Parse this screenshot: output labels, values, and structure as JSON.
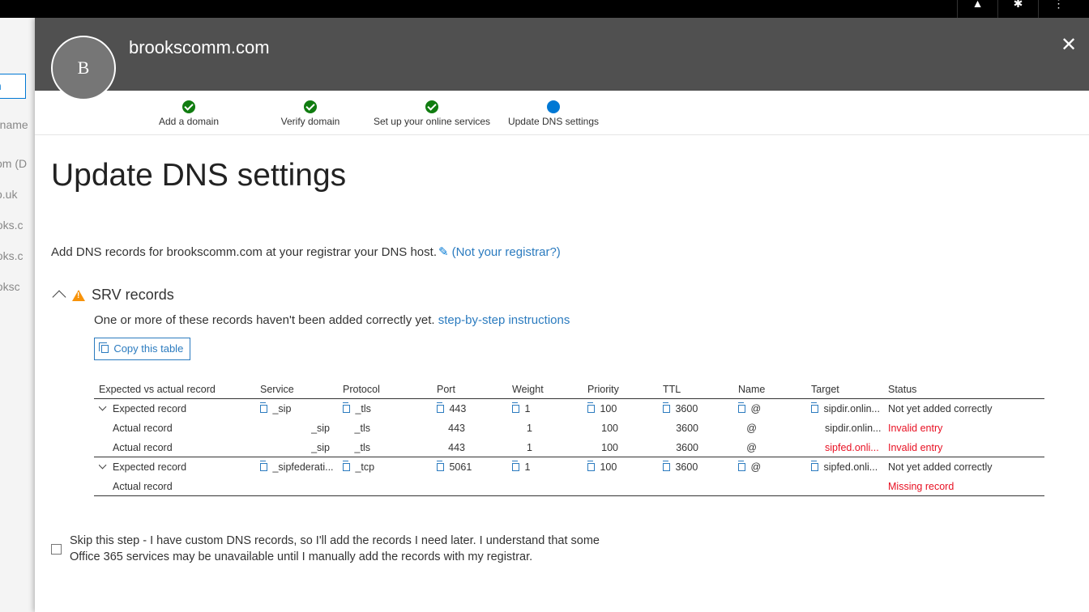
{
  "bg_page": {
    "button_label": "ain",
    "rows": [
      "n name",
      "com (D",
      "co.uk",
      "ooks.c",
      "ooks.c",
      "ooksc"
    ]
  },
  "panel": {
    "avatar_letter": "B",
    "title": "brookscomm.com",
    "close_label": "✕"
  },
  "steps": [
    {
      "label": "Add a domain",
      "state": "done"
    },
    {
      "label": "Verify domain",
      "state": "done"
    },
    {
      "label": "Set up your online services",
      "state": "done"
    },
    {
      "label": "Update DNS settings",
      "state": "current"
    }
  ],
  "page_title": "Update DNS settings",
  "intro": {
    "text": "Add DNS records for brookscomm.com at your registrar your DNS host.",
    "link": "(Not your registrar?)"
  },
  "srv": {
    "title": "SRV records",
    "message": "One or more of these records haven't been added correctly yet.",
    "link": "step-by-step instructions",
    "copy_button": "Copy this table"
  },
  "table": {
    "headers": [
      "Expected vs actual record",
      "Service",
      "Protocol",
      "Port",
      "Weight",
      "Priority",
      "TTL",
      "Name",
      "Target",
      "Status"
    ],
    "rows": [
      {
        "kind": "expected",
        "label": "Expected record",
        "service": "_sip",
        "protocol": "_tls",
        "port": "443",
        "weight": "1",
        "priority": "100",
        "ttl": "3600",
        "name": "@",
        "target": "sipdir.onlin...",
        "status": "Not yet added correctly"
      },
      {
        "kind": "actual",
        "label": "Actual record",
        "service": "_sip",
        "protocol": "_tls",
        "port": "443",
        "weight": "1",
        "priority": "100",
        "ttl": "3600",
        "name": "@",
        "target": "sipdir.onlin...",
        "status": "Invalid entry"
      },
      {
        "kind": "actual",
        "label": "Actual record",
        "service": "_sip",
        "protocol": "_tls",
        "port": "443",
        "weight": "1",
        "priority": "100",
        "ttl": "3600",
        "name": "@",
        "target": "sipfed.onli...",
        "status": "Invalid entry"
      },
      {
        "kind": "expected",
        "label": "Expected record",
        "service": "_sipfederati...",
        "protocol": "_tcp",
        "port": "5061",
        "weight": "1",
        "priority": "100",
        "ttl": "3600",
        "name": "@",
        "target": "sipfed.onli...",
        "status": "Not yet added correctly"
      },
      {
        "kind": "actual",
        "label": "Actual record",
        "service": "",
        "protocol": "",
        "port": "",
        "weight": "",
        "priority": "",
        "ttl": "",
        "name": "",
        "target": "",
        "status": "Missing record"
      }
    ]
  },
  "skip": {
    "line1": "Skip this step - I have custom DNS records, so I'll add the records I need later. I understand that some",
    "line2": "Office 365 services may be unavailable until I manually add the records with my registrar."
  },
  "colors": {
    "header_bg": "#505050",
    "accent": "#0078d4",
    "link": "#2b7bbf",
    "done": "#107c10",
    "warning": "#f7930a",
    "error": "#e81123"
  },
  "icons": [
    "bell-icon",
    "gear-icon",
    "more-icon",
    "pencil-icon",
    "warning-icon",
    "copy-icon",
    "close-icon",
    "chevron-up-icon",
    "chevron-down-icon"
  ]
}
